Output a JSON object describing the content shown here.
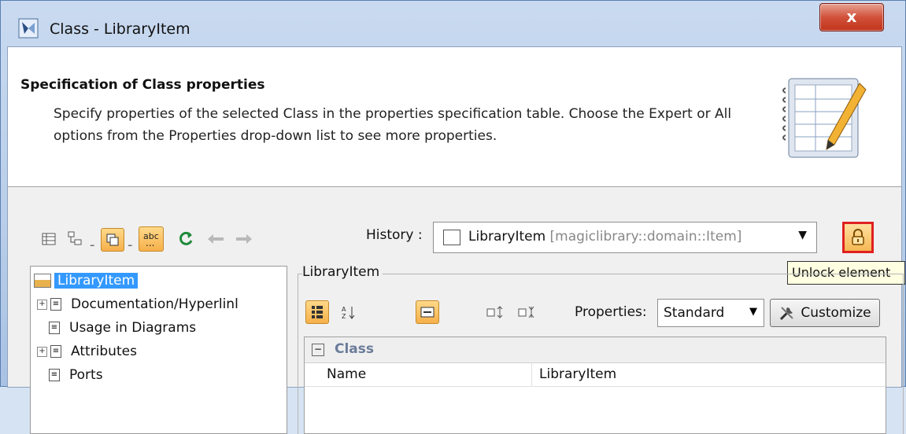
{
  "window": {
    "title": "Class - LibraryItem",
    "close_glyph": "x"
  },
  "header": {
    "title": "Specification of Class properties",
    "description": "Specify properties of the selected Class in the properties specification table. Choose the Expert or All options from the Properties drop-down list to see more properties."
  },
  "toolbar": {
    "history_label": "History :",
    "history_value": "LibraryItem",
    "history_qualifier": "[magiclibrary::domain::Item]",
    "tooltip": "Unlock element"
  },
  "tree": {
    "items": [
      {
        "label": "LibraryItem",
        "selected": true
      },
      {
        "label": "Documentation/Hyperlinl",
        "expandable": true
      },
      {
        "label": "Usage in Diagrams",
        "expandable": false
      },
      {
        "label": "Attributes",
        "expandable": true
      },
      {
        "label": "Ports",
        "expandable": false
      }
    ]
  },
  "properties_panel": {
    "group_title": "LibraryItem",
    "properties_label": "Properties:",
    "properties_value": "Standard",
    "customize_label": "Customize",
    "category": "Class",
    "rows": [
      {
        "key": "Name",
        "value": "LibraryItem"
      }
    ]
  },
  "colors": {
    "accent_orange": "#f6b04a",
    "selection_blue": "#3399ff",
    "lock_border": "#e02020"
  }
}
